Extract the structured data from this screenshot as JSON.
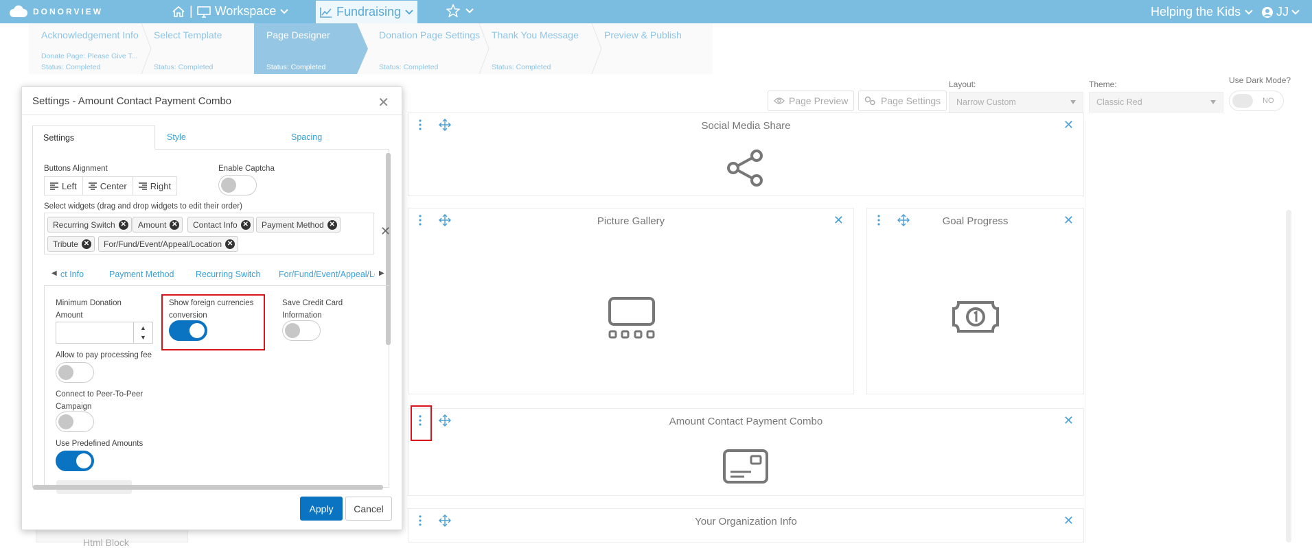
{
  "nav": {
    "logo": "DONORVIEW",
    "workspace": "Workspace",
    "fundraising": "Fundraising",
    "separator": "|",
    "org": "Helping the Kids",
    "user": "JJ"
  },
  "steps": [
    {
      "title": "Acknowledgement Info",
      "subtitle": "Donate Page: Please Give T...",
      "status": "Status: Completed"
    },
    {
      "title": "Select Template",
      "subtitle": "",
      "status": "Status: Completed"
    },
    {
      "title": "Page Designer",
      "subtitle": "",
      "status": "Status: Completed"
    },
    {
      "title": "Donation Page Settings",
      "subtitle": "",
      "status": "Status: Completed"
    },
    {
      "title": "Thank You Message",
      "subtitle": "",
      "status": "Status: Completed"
    },
    {
      "title": "Preview & Publish",
      "subtitle": "",
      "status": ""
    }
  ],
  "toolbar": {
    "page_preview": "Page Preview",
    "page_settings": "Page Settings",
    "layout_label": "Layout:",
    "layout_value": "Narrow Custom",
    "theme_label": "Theme:",
    "theme_value": "Classic Red",
    "dark_mode_label": "Use Dark Mode?",
    "dark_mode_value": "NO"
  },
  "widgets": {
    "social": "Social Media Share",
    "gallery": "Picture Gallery",
    "goal": "Goal Progress",
    "combo": "Amount Contact Payment Combo",
    "org_info": "Your Organization Info",
    "html_block": "Html Block"
  },
  "dialog": {
    "title": "Settings - Amount Contact Payment Combo",
    "tabs": [
      "Settings",
      "Style",
      "Spacing"
    ],
    "buttons_alignment_label": "Buttons Alignment",
    "align_buttons": [
      "Left",
      "Center",
      "Right"
    ],
    "enable_captcha_label": "Enable Captcha",
    "select_widgets_label": "Select widgets (drag and drop widgets to edit their order)",
    "selected_widgets": [
      "Recurring Switch",
      "Amount",
      "Contact Info",
      "Payment Method",
      "Tribute",
      "For/Fund/Event/Appeal/Location"
    ],
    "subtabs": [
      "ct Info",
      "Payment Method",
      "Recurring Switch",
      "For/Fund/Event/Appeal/Lo"
    ],
    "min_donation_label": "Minimum Donation Amount",
    "min_donation_value": "",
    "foreign_currency_label": "Show foreign currencies conversion",
    "save_card_label": "Save Credit Card Information",
    "processing_fee_label": "Allow to pay processing fee",
    "peer_label": "Connect to Peer-To-Peer Campaign",
    "predefined_label": "Use Predefined Amounts",
    "apply": "Apply",
    "cancel": "Cancel"
  },
  "colors": {
    "nav_bg": "#7bbde0",
    "accent": "#0a73c2",
    "link": "#39a0d8",
    "highlight": "#d9151b"
  },
  "icons": [
    "home-icon",
    "monitor-icon",
    "chart-icon",
    "star-icon",
    "user-icon",
    "eye-icon",
    "gear-icon",
    "share-icon",
    "gallery-icon",
    "money-icon",
    "card-icon"
  ]
}
